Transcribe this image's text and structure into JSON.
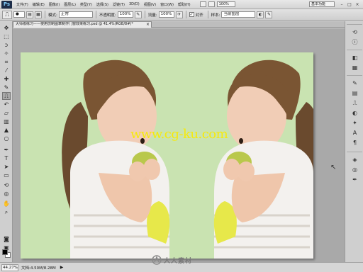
{
  "app": {
    "logo": "Ps",
    "menu": [
      "文件(F)",
      "编辑(E)",
      "图像(I)",
      "图层(L)",
      "类型(Y)",
      "选择(S)",
      "滤镜(T)",
      "3D(D)",
      "视图(V)",
      "窗口(W)",
      "帮助(H)"
    ],
    "workspace_zoom": "100%",
    "workspace_name": "基本功能",
    "window_buttons": [
      "–",
      "□",
      "×"
    ]
  },
  "options": {
    "mode_label": "模式:",
    "mode_value": "正常",
    "opacity_label": "不透明度:",
    "opacity_value": "100%",
    "flow_label": "流量:",
    "flow_value": "100%",
    "aligned_label": "对齐",
    "sample_label": "样本:",
    "sample_value": "当前图层"
  },
  "document": {
    "tab_title": "大师级练习——使用仿制图章制作门窗效果练习.psd @ 41.4%(RGB/8#)*",
    "tab_close": "×"
  },
  "canvas": {
    "background_color": "#c9e3b1",
    "watermark": "www.cg-ku.com"
  },
  "status": {
    "zoom": "44.27%",
    "doc_info": "文档:4.50M/8.28M"
  },
  "footer_logo": "人人素材"
}
